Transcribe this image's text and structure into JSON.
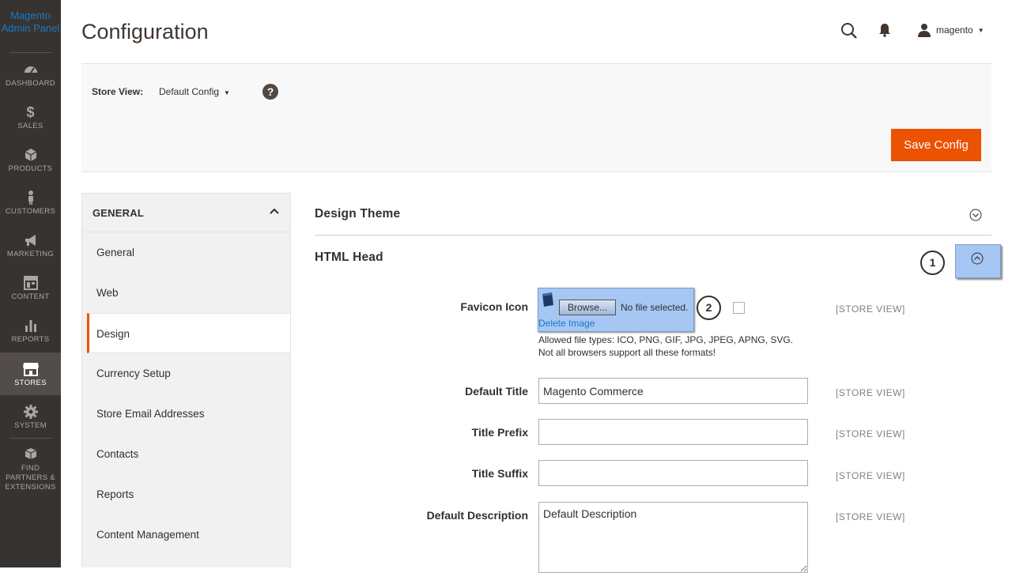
{
  "sidebar": {
    "logo": "Magento Admin Panel",
    "items": [
      {
        "label": "DASHBOARD",
        "icon": "dashboard-icon"
      },
      {
        "label": "SALES",
        "icon": "dollar-icon"
      },
      {
        "label": "PRODUCTS",
        "icon": "cube-icon"
      },
      {
        "label": "CUSTOMERS",
        "icon": "person-icon"
      },
      {
        "label": "MARKETING",
        "icon": "megaphone-icon"
      },
      {
        "label": "CONTENT",
        "icon": "layout-icon"
      },
      {
        "label": "REPORTS",
        "icon": "bar-chart-icon"
      },
      {
        "label": "STORES",
        "icon": "store-icon"
      },
      {
        "label": "SYSTEM",
        "icon": "gear-icon"
      },
      {
        "label": "FIND PARTNERS & EXTENSIONS",
        "icon": "boxes-icon"
      }
    ],
    "active": "STORES"
  },
  "header": {
    "title": "Configuration",
    "user": "magento"
  },
  "toolbar": {
    "store_view_label": "Store View:",
    "store_view_value": "Default Config",
    "help": "?",
    "save_label": "Save Config"
  },
  "left_nav": {
    "group": "GENERAL",
    "items": [
      "General",
      "Web",
      "Design",
      "Currency Setup",
      "Store Email Addresses",
      "Contacts",
      "Reports",
      "Content Management"
    ],
    "active": "Design"
  },
  "main": {
    "section1": "Design Theme",
    "section2": "HTML Head",
    "badge1": "1",
    "badge2": "2",
    "favicon": {
      "label": "Favicon Icon",
      "browse": "Browse...",
      "no_file": "No file selected.",
      "delete": "Delete Image",
      "note": "Allowed file types: ICO, PNG, GIF, JPG, JPEG, APNG, SVG. Not all browsers support all these formats!",
      "scope": "[STORE VIEW]"
    },
    "fields": [
      {
        "label": "Default Title",
        "value": "Magento Commerce",
        "scope": "[STORE VIEW]"
      },
      {
        "label": "Title Prefix",
        "value": "",
        "scope": "[STORE VIEW]"
      },
      {
        "label": "Title Suffix",
        "value": "",
        "scope": "[STORE VIEW]"
      },
      {
        "label": "Default Description",
        "value": "Default Description",
        "scope": "[STORE VIEW]"
      }
    ]
  },
  "colors": {
    "sidebar_bg": "#373330",
    "accent": "#eb5202",
    "highlight": "#a6c6f4"
  }
}
